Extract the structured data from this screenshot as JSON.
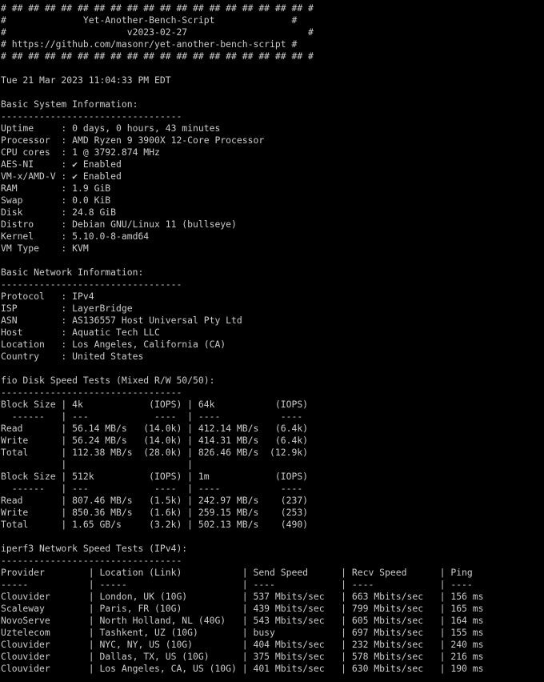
{
  "terminal": {
    "lines": [
      "# ## ## ## ## ## ## ## ## ## ## ## ## ## ## ## ## ## ## #",
      "#              Yet-Another-Bench-Script              #",
      "#                      v2023-02-27                      #",
      "# https://github.com/masonr/yet-another-bench-script #",
      "# ## ## ## ## ## ## ## ## ## ## ## ## ## ## ## ## ## ## #",
      "",
      "Tue 21 Mar 2023 11:04:33 PM EDT",
      "",
      "Basic System Information:",
      "---------------------------------",
      "Uptime     : 0 days, 0 hours, 43 minutes",
      "Processor  : AMD Ryzen 9 3900X 12-Core Processor",
      "CPU cores  : 1 @ 3792.874 MHz",
      "AES-NI     : ✔ Enabled",
      "VM-x/AMD-V : ✔ Enabled",
      "RAM        : 1.9 GiB",
      "Swap       : 0.0 KiB",
      "Disk       : 24.8 GiB",
      "Distro     : Debian GNU/Linux 11 (bullseye)",
      "Kernel     : 5.10.0-8-amd64",
      "VM Type    : KVM",
      "",
      "Basic Network Information:",
      "---------------------------------",
      "Protocol   : IPv4",
      "ISP        : LayerBridge",
      "ASN        : AS136557 Host Universal Pty Ltd",
      "Host       : Aquatic Tech LLC",
      "Location   : Los Angeles, California (CA)",
      "Country    : United States",
      "",
      "fio Disk Speed Tests (Mixed R/W 50/50):",
      "---------------------------------",
      "Block Size | 4k            (IOPS) | 64k           (IOPS)",
      "  ------   | ---            ----  | ----           ----",
      "Read       | 56.14 MB/s   (14.0k) | 412.14 MB/s   (6.4k)",
      "Write      | 56.24 MB/s   (14.0k) | 414.31 MB/s   (6.4k)",
      "Total      | 112.38 MB/s  (28.0k) | 826.46 MB/s  (12.9k)",
      "           |                      |",
      "Block Size | 512k          (IOPS) | 1m            (IOPS)",
      "  ------   | ---            ----  | ----           ----",
      "Read       | 807.46 MB/s   (1.5k) | 242.97 MB/s    (237)",
      "Write      | 850.36 MB/s   (1.6k) | 259.15 MB/s    (253)",
      "Total      | 1.65 GB/s     (3.2k) | 502.13 MB/s    (490)",
      "",
      "iperf3 Network Speed Tests (IPv4):",
      "---------------------------------",
      "Provider        | Location (Link)           | Send Speed      | Recv Speed      | Ping",
      "-----           | -----                     | ----            | ----            | ----",
      "Clouvider       | London, UK (10G)          | 537 Mbits/sec   | 663 Mbits/sec   | 156 ms",
      "Scaleway        | Paris, FR (10G)           | 439 Mbits/sec   | 799 Mbits/sec   | 165 ms",
      "NovoServe       | North Holland, NL (40G)   | 543 Mbits/sec   | 605 Mbits/sec   | 164 ms",
      "Uztelecom       | Tashkent, UZ (10G)        | busy            | 697 Mbits/sec   | 155 ms",
      "Clouvider       | NYC, NY, US (10G)         | 404 Mbits/sec   | 232 Mbits/sec   | 240 ms",
      "Clouvider       | Dallas, TX, US (10G)      | 375 Mbits/sec   | 578 Mbits/sec   | 216 ms",
      "Clouvider       | Los Angeles, CA, US (10G) | 401 Mbits/sec   | 630 Mbits/sec   | 190 ms"
    ]
  }
}
